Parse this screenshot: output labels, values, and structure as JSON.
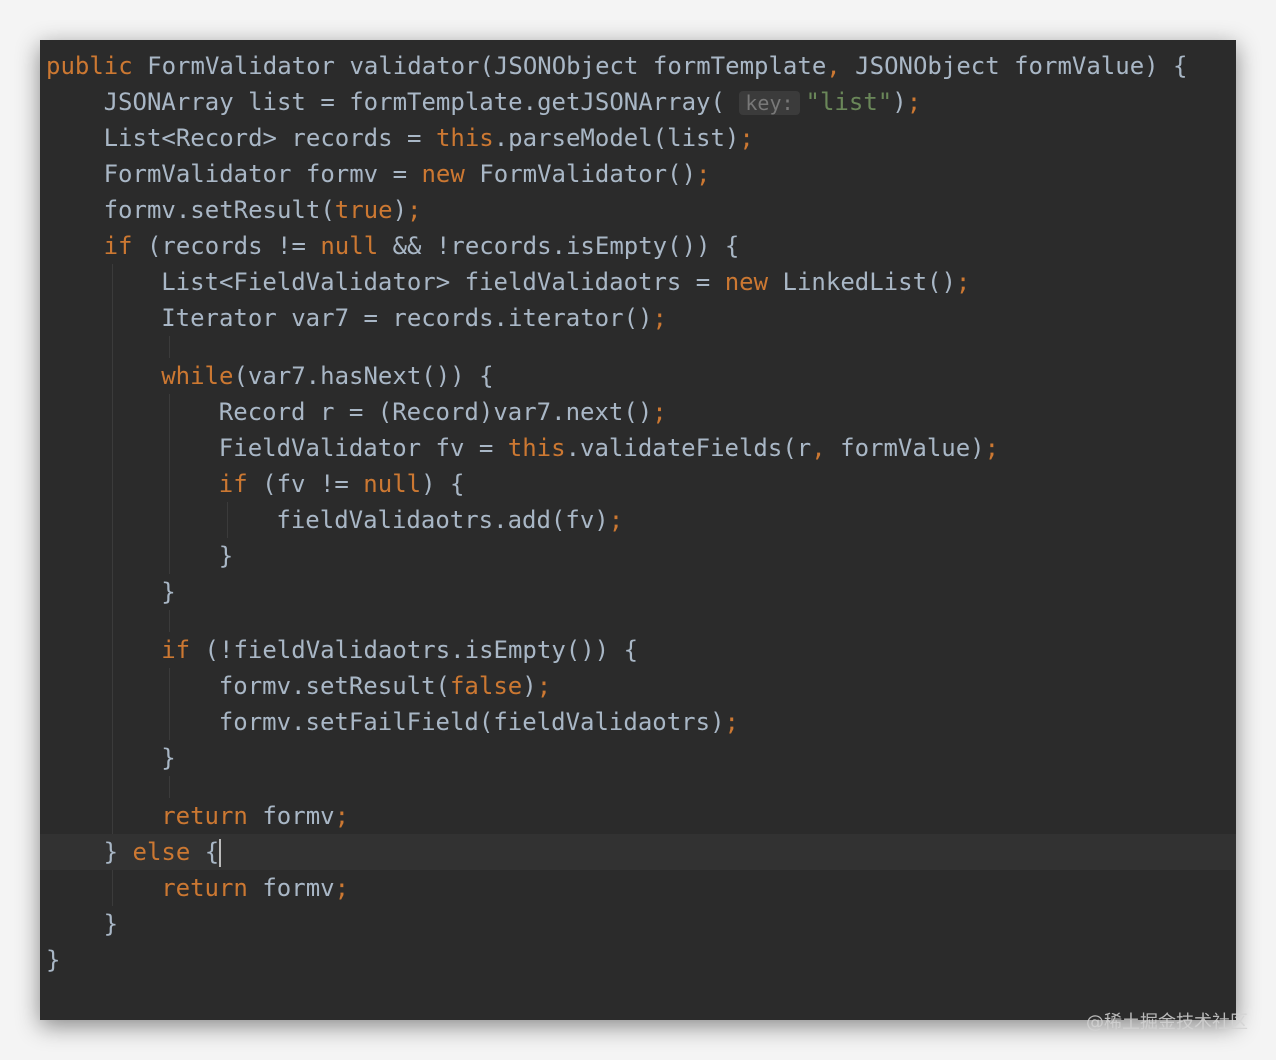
{
  "editor": {
    "colors": {
      "background": "#2b2b2b",
      "text": "#a9b7c6",
      "keyword": "#cc7832",
      "string": "#6a8759",
      "current_line": "#323232"
    },
    "lines": [
      [
        [
          "kw",
          "public"
        ],
        [
          "t",
          " FormValidator validator(JSONObject formTemplate"
        ],
        [
          "p",
          ","
        ],
        [
          "t",
          " JSONObject formValue) {"
        ]
      ],
      [
        [
          "t",
          "JSONArray list = formTemplate.getJSONArray( "
        ],
        [
          "h",
          "key:"
        ],
        [
          "s",
          "\"list\""
        ],
        [
          "t",
          ")"
        ],
        [
          "p",
          ";"
        ]
      ],
      [
        [
          "t",
          "List<Record> records = "
        ],
        [
          "kw",
          "this"
        ],
        [
          "t",
          ".parseModel(list)"
        ],
        [
          "p",
          ";"
        ]
      ],
      [
        [
          "t",
          "FormValidator formv = "
        ],
        [
          "kw",
          "new"
        ],
        [
          "t",
          " FormValidator()"
        ],
        [
          "p",
          ";"
        ]
      ],
      [
        [
          "t",
          "formv.setResult("
        ],
        [
          "kw",
          "true"
        ],
        [
          "t",
          ")"
        ],
        [
          "p",
          ";"
        ]
      ],
      [
        [
          "kw",
          "if"
        ],
        [
          "t",
          " (records != "
        ],
        [
          "kw",
          "null"
        ],
        [
          "t",
          " && !records.isEmpty()) {"
        ]
      ],
      [
        [
          "t",
          "List<FieldValidator> fieldValidaotrs = "
        ],
        [
          "kw",
          "new"
        ],
        [
          "t",
          " LinkedList()"
        ],
        [
          "p",
          ";"
        ]
      ],
      [
        [
          "t",
          "Iterator var7 = records.iterator()"
        ],
        [
          "p",
          ";"
        ]
      ],
      [],
      [
        [
          "kw",
          "while"
        ],
        [
          "t",
          "(var7.hasNext()) {"
        ]
      ],
      [
        [
          "t",
          "Record r = (Record)var7.next()"
        ],
        [
          "p",
          ";"
        ]
      ],
      [
        [
          "t",
          "FieldValidator fv = "
        ],
        [
          "kw",
          "this"
        ],
        [
          "t",
          ".validateFields(r"
        ],
        [
          "p",
          ","
        ],
        [
          "t",
          " formValue)"
        ],
        [
          "p",
          ";"
        ]
      ],
      [
        [
          "kw",
          "if"
        ],
        [
          "t",
          " (fv != "
        ],
        [
          "kw",
          "null"
        ],
        [
          "t",
          ") {"
        ]
      ],
      [
        [
          "t",
          "fieldValidaotrs.add(fv)"
        ],
        [
          "p",
          ";"
        ]
      ],
      [
        [
          "t",
          "}"
        ]
      ],
      [
        [
          "t",
          "}"
        ]
      ],
      [],
      [
        [
          "kw",
          "if"
        ],
        [
          "t",
          " (!fieldValidaotrs.isEmpty()) {"
        ]
      ],
      [
        [
          "t",
          "formv.setResult("
        ],
        [
          "kw",
          "false"
        ],
        [
          "t",
          ")"
        ],
        [
          "p",
          ";"
        ]
      ],
      [
        [
          "t",
          "formv.setFailField(fieldValidaotrs)"
        ],
        [
          "p",
          ";"
        ]
      ],
      [
        [
          "t",
          "}"
        ]
      ],
      [],
      [
        [
          "kw",
          "return"
        ],
        [
          "t",
          " formv"
        ],
        [
          "p",
          ";"
        ]
      ],
      [
        [
          "t",
          "} "
        ],
        [
          "kw",
          "else"
        ],
        [
          "t",
          " {"
        ],
        [
          "c",
          ""
        ]
      ],
      [
        [
          "kw",
          "return"
        ],
        [
          "t",
          " formv"
        ],
        [
          "p",
          ";"
        ]
      ],
      [
        [
          "t",
          "}"
        ]
      ],
      [
        [
          "t",
          "}"
        ]
      ]
    ]
  },
  "watermark": "@稀土掘金技术社区"
}
